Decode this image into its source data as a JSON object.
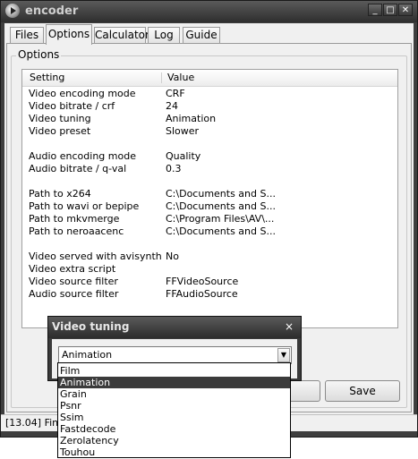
{
  "window": {
    "title": "encoder",
    "minimize": "_",
    "maximize": "□",
    "close": "✕"
  },
  "tabs": [
    {
      "label": "Files"
    },
    {
      "label": "Options"
    },
    {
      "label": "Calculator"
    },
    {
      "label": "Log"
    },
    {
      "label": "Guide"
    }
  ],
  "options": {
    "group_label": "Options",
    "columns": {
      "setting": "Setting",
      "value": "Value"
    },
    "rows": [
      {
        "k": "Video encoding mode",
        "v": "CRF"
      },
      {
        "k": "Video bitrate / crf",
        "v": "24"
      },
      {
        "k": "Video tuning",
        "v": "Animation"
      },
      {
        "k": "Video preset",
        "v": "Slower"
      },
      {
        "k": "Audio encoding mode",
        "v": "Quality"
      },
      {
        "k": "Audio bitrate / q-val",
        "v": "0.3"
      },
      {
        "k": "Path to x264",
        "v": "C:\\Documents and S..."
      },
      {
        "k": "Path to wavi or bepipe",
        "v": "C:\\Documents and S..."
      },
      {
        "k": "Path to mkvmerge",
        "v": "C:\\Program Files\\AV\\..."
      },
      {
        "k": "Path to neroaacenc",
        "v": "C:\\Documents and S..."
      },
      {
        "k": "Video served with avisynth",
        "v": "No"
      },
      {
        "k": "Video extra script",
        "v": ""
      },
      {
        "k": "Video source filter",
        "v": "FFVideoSource"
      },
      {
        "k": "Audio source filter",
        "v": "FFAudioSource"
      }
    ],
    "save_label": "Save",
    "load_label": ""
  },
  "status": {
    "text": "[13.04] Finis"
  },
  "dialog": {
    "title": "Video tuning",
    "close": "×",
    "selected": "Animation",
    "options": [
      "Film",
      "Animation",
      "Grain",
      "Psnr",
      "Ssim",
      "Fastdecode",
      "Zerolatency",
      "Touhou"
    ],
    "selected_index": 1
  }
}
